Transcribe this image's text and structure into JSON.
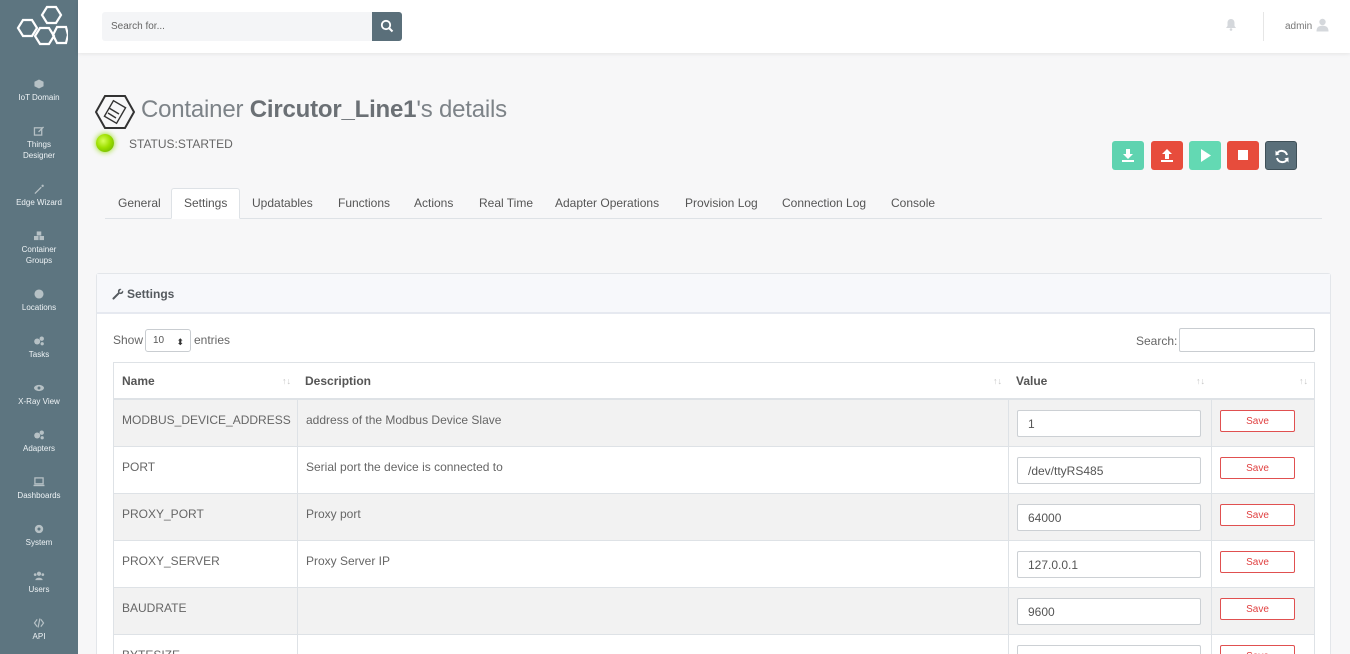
{
  "colors": {
    "sidebar": "#5d7580",
    "download_btn": "#5fd3b0",
    "upload_btn": "#e74c3c",
    "play_btn": "#63d9b3",
    "stop_btn": "#e74c3c",
    "refresh_btn": "#5a6f7a",
    "status_led": "#9ee000"
  },
  "sidebar": {
    "logo_icon": "hexagon-logo-icon",
    "items": [
      {
        "label": "IoT Domain",
        "icon": "cube-icon"
      },
      {
        "label": "Things Designer",
        "icon": "edit-icon"
      },
      {
        "label": "Edge Wizard",
        "icon": "magic-wand-icon"
      },
      {
        "label": "Container Groups",
        "icon": "cubes-icon"
      },
      {
        "label": "Locations",
        "icon": "globe-icon"
      },
      {
        "label": "Tasks",
        "icon": "cogs-icon"
      },
      {
        "label": "X-Ray View",
        "icon": "eye-icon"
      },
      {
        "label": "Adapters",
        "icon": "cogs-icon"
      },
      {
        "label": "Dashboards",
        "icon": "laptop-icon"
      },
      {
        "label": "System",
        "icon": "cog-icon"
      },
      {
        "label": "Users",
        "icon": "users-icon"
      },
      {
        "label": "API",
        "icon": "code-icon"
      }
    ]
  },
  "topbar": {
    "search_placeholder": "Search for...",
    "user": "admin"
  },
  "header": {
    "title_prefix": "Container ",
    "container_name": "Circutor_Line1",
    "title_suffix": "'s details",
    "status": "STATUS:STARTED"
  },
  "tabs": [
    {
      "label": "General",
      "active": false
    },
    {
      "label": "Settings",
      "active": true
    },
    {
      "label": "Updatables",
      "active": false
    },
    {
      "label": "Functions",
      "active": false
    },
    {
      "label": "Actions",
      "active": false
    },
    {
      "label": "Real Time",
      "active": false
    },
    {
      "label": "Adapter Operations",
      "active": false
    },
    {
      "label": "Provision Log",
      "active": false
    },
    {
      "label": "Connection Log",
      "active": false
    },
    {
      "label": "Console",
      "active": false
    }
  ],
  "settings": {
    "title": "Settings",
    "show_label": "Show",
    "entries_select": "10",
    "entries_label": "entries",
    "search_label": "Search:",
    "columns": [
      "Name",
      "Description",
      "Value",
      ""
    ],
    "save_label": "Save",
    "rows": [
      {
        "name": "MODBUS_DEVICE_ADDRESS",
        "description": "address of the Modbus Device Slave",
        "value": "1"
      },
      {
        "name": "PORT",
        "description": "Serial port the device is connected to",
        "value": "/dev/ttyRS485"
      },
      {
        "name": "PROXY_PORT",
        "description": "Proxy port",
        "value": "64000"
      },
      {
        "name": "PROXY_SERVER",
        "description": "Proxy Server IP",
        "value": "127.0.0.1"
      },
      {
        "name": "BAUDRATE",
        "description": "",
        "value": "9600"
      },
      {
        "name": "BYTESIZE",
        "description": "",
        "value": ""
      }
    ]
  }
}
